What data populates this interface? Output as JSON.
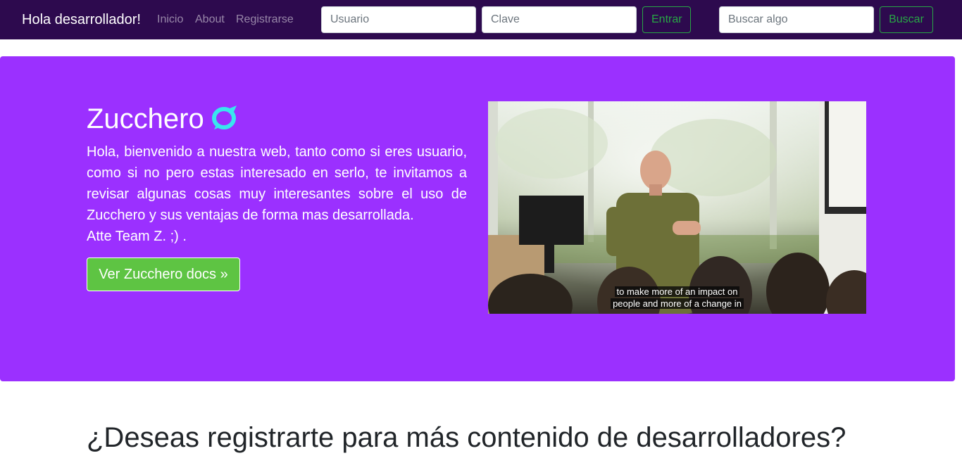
{
  "navbar": {
    "brand": "Hola desarrollador!",
    "links": [
      "Inicio",
      "About",
      "Registrarse"
    ],
    "login": {
      "user_placeholder": "Usuario",
      "password_placeholder": "Clave",
      "submit_label": "Entrar"
    },
    "search": {
      "placeholder": "Buscar algo",
      "button_label": "Buscar"
    }
  },
  "hero": {
    "title": "Zucchero",
    "logo_icon": "zucchero-logo-icon",
    "description": "Hola, bienvenido a nuestra web, tanto como si eres usuario, como si no pero estas interesado en serlo, te invitamos a revisar algunas cosas muy interesantes sobre el uso de Zucchero y sus ventajas de forma mas desarrollada.",
    "signature": "Atte Team Z. ;) .",
    "docs_button": "Ver Zucchero docs »",
    "video": {
      "caption_line1": "to make more of an impact on",
      "caption_line2": "people and more of a change in"
    }
  },
  "section": {
    "heading": "¿Deseas registrarte para más contenido de desarrolladores?"
  },
  "colors": {
    "navbar_bg": "#2d0a4e",
    "hero_bg": "#9b30ff",
    "success": "#28a745",
    "docs_button": "#5ec443",
    "logo_accent": "#39e6ee"
  }
}
